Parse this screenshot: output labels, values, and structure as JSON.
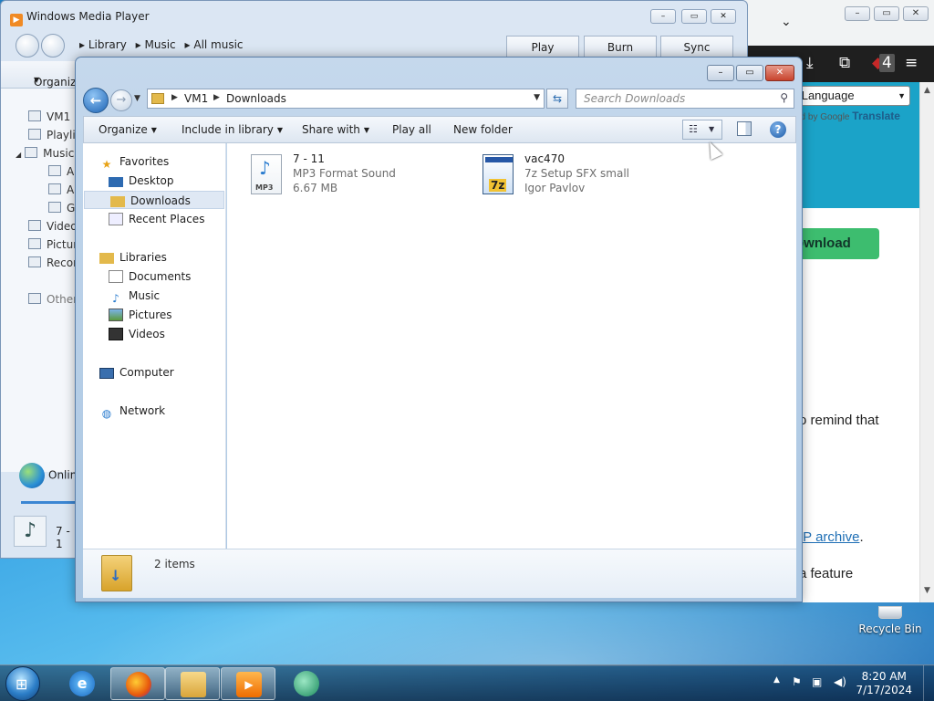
{
  "browser": {
    "language_select": "ct Language",
    "translate_prefix": "ed by",
    "translate_brand": "Google",
    "translate_label": "Translate",
    "download_button": "ownload",
    "text_remind": "o remind that",
    "zip_link": "IP archive",
    "zip_period": ".",
    "text_feature": "a feature",
    "extension_badge": "4"
  },
  "wmp": {
    "title": "Windows Media Player",
    "breadcrumb": [
      "Library",
      "Music",
      "All music"
    ],
    "tabs": [
      "Play",
      "Burn",
      "Sync"
    ],
    "organize": "Organize",
    "sidebar": [
      "VM1",
      "Playlis",
      "Music",
      "Ar",
      "Al",
      "Ge",
      "Video",
      "Pictur",
      "Recor",
      "Other"
    ],
    "online": "Onlin",
    "now_playing": "7 - 1"
  },
  "explorer": {
    "address": [
      "VM1",
      "Downloads"
    ],
    "search_placeholder": "Search Downloads",
    "commands": {
      "organize": "Organize",
      "include": "Include in library",
      "share": "Share with",
      "play_all": "Play all",
      "new_folder": "New folder"
    },
    "nav": {
      "favorites": "Favorites",
      "desktop": "Desktop",
      "downloads": "Downloads",
      "recent": "Recent Places",
      "libraries": "Libraries",
      "documents": "Documents",
      "music": "Music",
      "pictures": "Pictures",
      "videos": "Videos",
      "computer": "Computer",
      "network": "Network"
    },
    "files": [
      {
        "name": "7 - 11",
        "type": "MP3 Format Sound",
        "detail": "6.67 MB",
        "icon_label": "MP3"
      },
      {
        "name": "vac470",
        "type": "7z Setup SFX small",
        "detail": "Igor Pavlov",
        "icon_label": "7z"
      }
    ],
    "item_count": "2 items"
  },
  "desktop": {
    "recycle_bin": "Recycle Bin"
  },
  "taskbar": {
    "time": "8:20 AM",
    "date": "7/17/2024"
  },
  "colors": {
    "accent": "#1e64b5",
    "browser_teal": "#1ba3c8",
    "download_green": "#3dbd6f"
  }
}
